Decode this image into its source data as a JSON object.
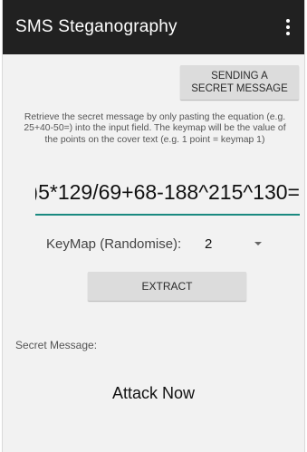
{
  "appbar": {
    "title": "SMS Steganography",
    "overflow_icon": "more-vert-icon"
  },
  "send_button": {
    "label_line1": "SENDING A",
    "label_line2": "SECRET MESSAGE"
  },
  "instructions": "Retrieve the secret message by only pasting the equation (e.g. 25+40-50=) into the input field. The keymap will be the value of the points on the cover text (e.g. 1 point = keymap 1)",
  "equation_field": {
    "value": ")5*129/69+68-188^215^130="
  },
  "keymap": {
    "label": "KeyMap (Randomise):",
    "selected": "2"
  },
  "extract_button": {
    "label": "EXTRACT"
  },
  "secret": {
    "label": "Secret Message:",
    "message": "Attack Now"
  },
  "colors": {
    "appbar": "#212121",
    "accent_underline": "#1a8a80",
    "button_bg": "#dcdcdc",
    "background": "#f2f2f2"
  }
}
